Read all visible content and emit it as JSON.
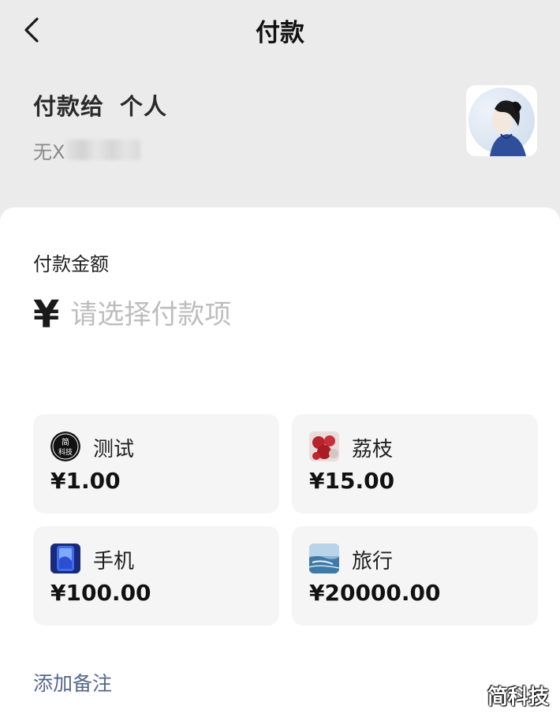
{
  "header": {
    "title": "付款",
    "back_icon": "chevron-left-icon"
  },
  "payee": {
    "prefix": "付款给",
    "type": "个人",
    "name_visible": "无X"
  },
  "amount": {
    "label": "付款金额",
    "currency": "¥",
    "placeholder": "请选择付款项"
  },
  "items": [
    {
      "name": "测试",
      "price": "¥1.00"
    },
    {
      "name": "荔枝",
      "price": "¥15.00"
    },
    {
      "name": "手机",
      "price": "¥100.00"
    },
    {
      "name": "旅行",
      "price": "¥20000.00"
    }
  ],
  "note_link": "添加备注",
  "watermark": "简科技",
  "logo_text": "简科技",
  "colors": {
    "header_bg": "#ebebeb",
    "card_bg": "#f5f5f5",
    "link": "#56668c",
    "placeholder": "#bdbdbd"
  }
}
